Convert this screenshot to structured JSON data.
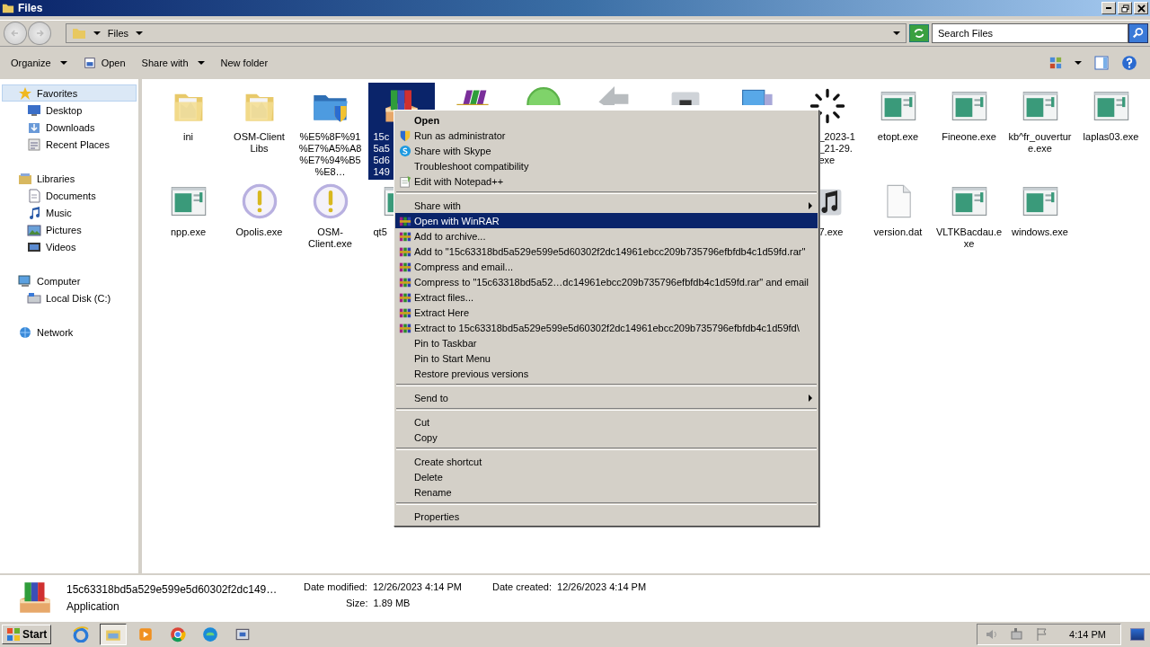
{
  "window": {
    "title": "Files"
  },
  "address_bar": {
    "path": "Files",
    "search": {
      "placeholder": "Search Files"
    }
  },
  "toolbar": {
    "items": [
      {
        "label": "Organize",
        "kind": "dropdown"
      },
      {
        "label": "Open",
        "kind": "open"
      },
      {
        "label": "Share with",
        "kind": "dropdown"
      },
      {
        "label": "New folder",
        "kind": "plain"
      }
    ]
  },
  "sidebar": {
    "groups": [
      {
        "label": "Favorites",
        "kind": "star",
        "selected": true,
        "children": [
          {
            "label": "Desktop",
            "kind": "desktop",
            "selected": false
          },
          {
            "label": "Downloads",
            "kind": "downloads",
            "selected": false
          },
          {
            "label": "Recent Places",
            "kind": "recent",
            "selected": false
          }
        ]
      },
      {
        "label": "Libraries",
        "kind": "libraries",
        "selected": false,
        "children": [
          {
            "label": "Documents",
            "kind": "documents",
            "selected": false
          },
          {
            "label": "Music",
            "kind": "music",
            "selected": false
          },
          {
            "label": "Pictures",
            "kind": "pictures",
            "selected": false
          },
          {
            "label": "Videos",
            "kind": "videos",
            "selected": false
          }
        ]
      },
      {
        "label": "Computer",
        "kind": "computer",
        "selected": false,
        "children": [
          {
            "label": "Local Disk (C:)",
            "kind": "disk",
            "selected": false
          }
        ]
      },
      {
        "label": "Network",
        "kind": "network",
        "selected": false
      }
    ]
  },
  "files": {
    "rows": [
      [
        {
          "label": "ini",
          "kind": "folder-doc",
          "selected": false
        },
        {
          "label": "OSM-Client Libs",
          "kind": "folder-doc",
          "selected": false
        },
        {
          "label": "%E5%8F%91%E7%A5%A8%E7%94%B5%E8…",
          "kind": "shield-folder",
          "selected": false
        },
        {
          "lines": [
            "15c",
            "5a5",
            "5d6",
            "149"
          ],
          "kind": "winrar-box",
          "selected": true
        },
        {
          "kind": "winrar-books",
          "selected": false
        },
        {
          "kind": "green-circle",
          "selected": false
        },
        {
          "kind": "grey-arrow",
          "selected": false
        },
        {
          "kind": "grey-folder",
          "selected": false
        },
        {
          "kind": "computer",
          "selected": false
        },
        {
          "lines": [
            "_2023-1",
            "_21-29.",
            "exe"
          ],
          "kind": "spinner",
          "selected": false
        },
        {
          "label": "etopt.exe",
          "kind": "app-window",
          "selected": false
        },
        {
          "label": "Fineone.exe",
          "kind": "app-window",
          "selected": false
        },
        {
          "label": "kb^fr_ouverture.exe",
          "kind": "app-window",
          "selected": false
        },
        {
          "label": "laplas03.exe",
          "kind": "app-window",
          "selected": false
        }
      ],
      [
        {
          "label": "npp.exe",
          "kind": "app-window",
          "selected": false
        },
        {
          "label": "Opolis.exe",
          "kind": "alert",
          "selected": false
        },
        {
          "label": "OSM-Client.exe",
          "kind": "alert",
          "selected": false
        },
        {
          "lines": [
            "qt5"
          ],
          "kind": "app-window",
          "selected": false
        },
        {
          "lines": [
            "7.exe"
          ],
          "kind": "music",
          "selected": false
        },
        {
          "label": "version.dat",
          "kind": "document",
          "selected": false
        },
        {
          "label": "VLTKBacdau.exe",
          "kind": "app-window",
          "selected": false
        },
        {
          "label": "windows.exe",
          "kind": "app-window",
          "selected": false
        }
      ]
    ]
  },
  "context_menu": {
    "items": [
      {
        "label": "Open",
        "kind": "default",
        "selected": false
      },
      {
        "label": "Run as administrator",
        "kind": "item",
        "selected": false
      },
      {
        "label": "Share with Skype",
        "kind": "item",
        "selected": false
      },
      {
        "label": "Troubleshoot compatibility",
        "kind": "item",
        "selected": false
      },
      {
        "label": "Edit with Notepad++",
        "kind": "item",
        "selected": false
      },
      {
        "kind": "separator"
      },
      {
        "label": "Share with",
        "kind": "submenu",
        "selected": false
      },
      {
        "label": "Open with WinRAR",
        "kind": "item",
        "selected": true
      },
      {
        "label": "Add to archive...",
        "kind": "item",
        "selected": false
      },
      {
        "label": "Add to \"15c63318bd5a529e599e5d60302f2dc14961ebcc209b735796efbfdb4c1d59fd.rar\"",
        "kind": "item",
        "selected": false
      },
      {
        "label": "Compress and email...",
        "kind": "item",
        "selected": false
      },
      {
        "label": "Compress to \"15c63318bd5a52…dc14961ebcc209b735796efbfdb4c1d59fd.rar\" and email",
        "kind": "item",
        "selected": false
      },
      {
        "label": "Extract files...",
        "kind": "item",
        "selected": false
      },
      {
        "label": "Extract Here",
        "kind": "item",
        "selected": false
      },
      {
        "label": "Extract to 15c63318bd5a529e599e5d60302f2dc14961ebcc209b735796efbfdb4c1d59fd\\",
        "kind": "item",
        "selected": false
      },
      {
        "label": "Pin to Taskbar",
        "kind": "item",
        "selected": false
      },
      {
        "label": "Pin to Start Menu",
        "kind": "item",
        "selected": false
      },
      {
        "label": "Restore previous versions",
        "kind": "item",
        "selected": false
      },
      {
        "kind": "separator"
      },
      {
        "label": "Send to",
        "kind": "submenu",
        "selected": false
      },
      {
        "kind": "separator"
      },
      {
        "label": "Cut",
        "kind": "item",
        "selected": false
      },
      {
        "label": "Copy",
        "kind": "item",
        "selected": false
      },
      {
        "kind": "separator"
      },
      {
        "label": "Create shortcut",
        "kind": "item",
        "selected": false
      },
      {
        "label": "Delete",
        "kind": "item",
        "selected": false
      },
      {
        "label": "Rename",
        "kind": "item",
        "selected": false
      },
      {
        "kind": "separator"
      },
      {
        "label": "Properties",
        "kind": "item",
        "selected": false
      }
    ]
  },
  "details": {
    "name": "15c63318bd5a529e599e5d60302f2dc149…",
    "type": "Application",
    "fields": [
      {
        "label": "Date modified:",
        "value": "12/26/2023 4:14 PM"
      },
      {
        "label": "Date created:",
        "value": "12/26/2023 4:14 PM"
      },
      {
        "label": "Size:",
        "value": "1.89 MB"
      }
    ]
  },
  "taskbar": {
    "start": "Start",
    "apps": [
      {
        "kind": "ie",
        "active": false
      },
      {
        "kind": "explorer",
        "active": true
      },
      {
        "kind": "media",
        "active": false
      },
      {
        "kind": "chrome",
        "active": false
      },
      {
        "kind": "edge",
        "active": false
      },
      {
        "kind": "app",
        "active": false
      }
    ],
    "clock": "4:14 PM"
  }
}
